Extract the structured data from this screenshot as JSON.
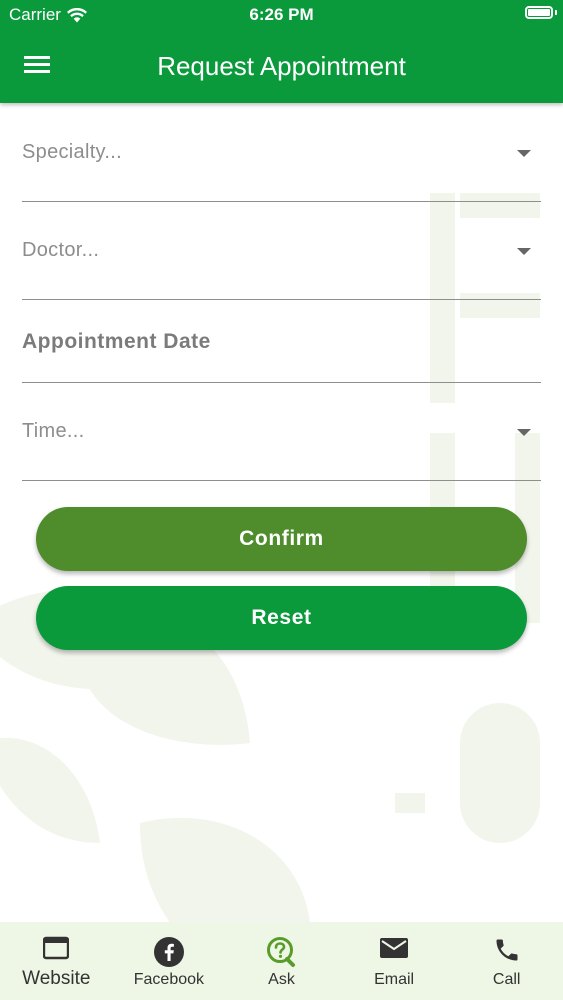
{
  "status_bar": {
    "carrier": "Carrier",
    "time": "6:26 PM"
  },
  "header": {
    "title": "Request Appointment",
    "menu_icon": "hamburger-menu-icon"
  },
  "form": {
    "specialty": {
      "placeholder": "Specialty..."
    },
    "doctor": {
      "placeholder": "Doctor..."
    },
    "appointment_date": {
      "label": "Appointment Date"
    },
    "time": {
      "placeholder": "Time..."
    }
  },
  "buttons": {
    "confirm": "Confirm",
    "reset": "Reset"
  },
  "tab_bar": {
    "items": [
      {
        "label": "Website",
        "icon": "browser-window-icon"
      },
      {
        "label": "Facebook",
        "icon": "facebook-icon"
      },
      {
        "label": "Ask",
        "icon": "question-bubble-icon"
      },
      {
        "label": "Email",
        "icon": "envelope-icon"
      },
      {
        "label": "Call",
        "icon": "phone-icon"
      }
    ]
  },
  "colors": {
    "primary_green": "#0a9a3c",
    "confirm_green": "#4e8c2c",
    "tab_bar_bg": "#eef7e6",
    "ask_icon_green": "#5a9c2a"
  }
}
